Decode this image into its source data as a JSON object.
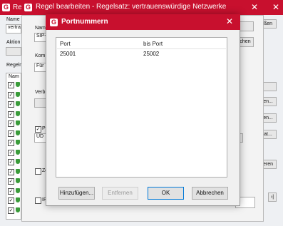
{
  "back_window": {
    "title": "Re",
    "labels": {
      "name": "Name",
      "value": "vertra",
      "aktion": "Aktion",
      "regel": "Regeln",
      "nam": "Nam"
    },
    "right_buttons": [
      "ßen",
      "",
      "",
      "en...",
      "en...",
      "at...",
      "eren"
    ]
  },
  "mid_window": {
    "title": "Regel bearbeiten - Regelsatz: vertrauenswürdige Netzwerke",
    "labels": {
      "name": "Nam",
      "name_value": "SIP-",
      "komm": "Kom",
      "komm_value": "Für",
      "verb": "Verb",
      "p": "P",
      "udp": "UD",
      "ze": "Ze",
      "ip": "IP"
    },
    "side_buttons": {
      "top": "",
      "suchen": "chen",
      "dots": "..."
    }
  },
  "dialog": {
    "title": "Portnummern",
    "columns": [
      "Port",
      "bis Port"
    ],
    "rows": [
      {
        "port": "25001",
        "bis_port": "25002"
      }
    ],
    "buttons": {
      "add": "Hinzufügen...",
      "remove": "Entfernen",
      "ok": "OK",
      "cancel": "Abbrechen"
    }
  },
  "colors": {
    "title_bar": "#c8102e",
    "dialog_body": "#f0f0f0"
  }
}
